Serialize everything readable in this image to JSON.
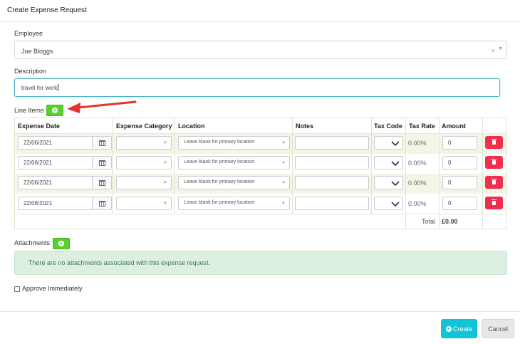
{
  "modal": {
    "title": "Create Expense Request"
  },
  "employee": {
    "label": "Employee",
    "value": "Joe Bloggs",
    "clear": "×",
    "caret": "▼"
  },
  "description": {
    "label": "Description",
    "value": "travel for work"
  },
  "line_items": {
    "label": "Line Items",
    "columns": [
      "Expense Date",
      "Expense Category",
      "Location",
      "Notes",
      "Tax Code",
      "Tax Rate",
      "Amount"
    ],
    "rows": [
      {
        "date": "22/06/2021",
        "category": "",
        "location": "Leave blank for primary location",
        "notes": "",
        "tax_code": "",
        "tax_rate": "0.00%",
        "amount": "0"
      },
      {
        "date": "22/06/2021",
        "category": "",
        "location": "Leave blank for primary location",
        "notes": "",
        "tax_code": "",
        "tax_rate": "0.00%",
        "amount": "0"
      },
      {
        "date": "22/06/2021",
        "category": "",
        "location": "Leave blank for primary location",
        "notes": "",
        "tax_code": "",
        "tax_rate": "0.00%",
        "amount": "0"
      },
      {
        "date": "22/06/2021",
        "category": "",
        "location": "Leave blank for primary location",
        "notes": "",
        "tax_code": "",
        "tax_rate": "0.00%",
        "amount": "0"
      }
    ],
    "total_label": "Total",
    "total_value": "£0.00"
  },
  "attachments": {
    "label": "Attachments",
    "empty_message": "There are no attachments associated with this expense request."
  },
  "approve": {
    "label": "Approve Immediately",
    "checked": false
  },
  "buttons": {
    "create": "Create",
    "cancel": "Cancel"
  },
  "colors": {
    "add_green": "#5ad02f",
    "delete_red": "#ef2f4d",
    "create_cyan": "#12c4d8",
    "arrow_red": "#e5352b",
    "alert_green": "#ddefe1"
  }
}
